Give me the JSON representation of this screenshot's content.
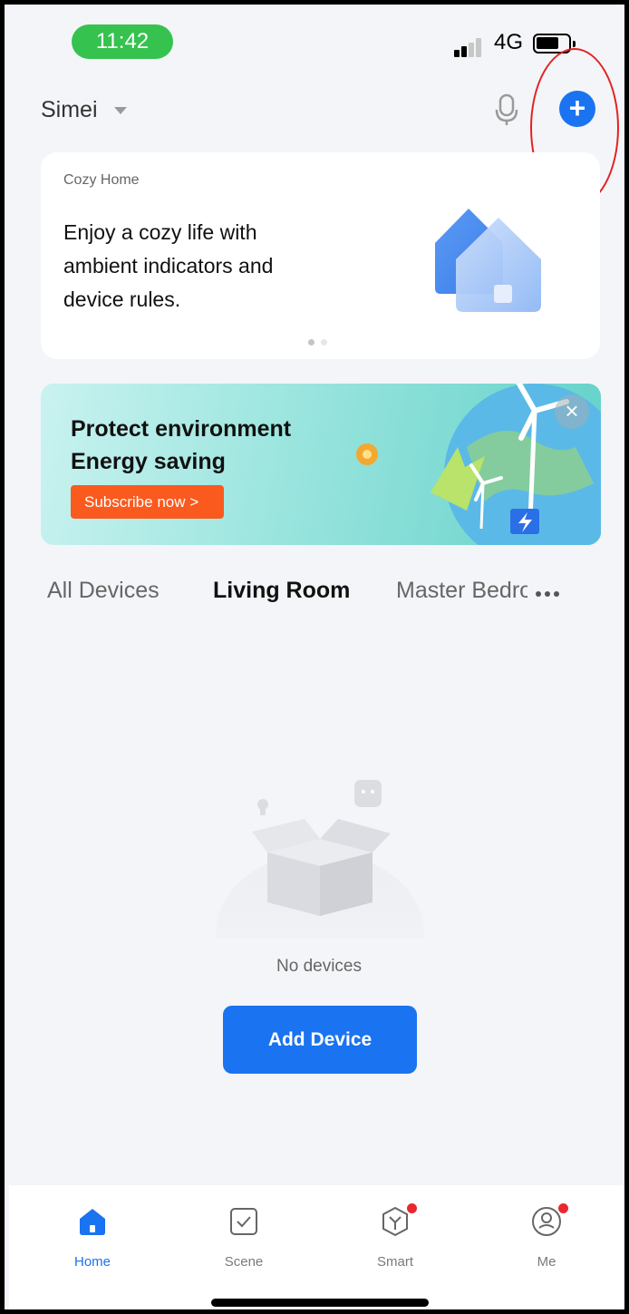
{
  "status_bar": {
    "time": "11:42",
    "network": "4G"
  },
  "header": {
    "home_name": "Simei"
  },
  "cozy_card": {
    "title": "Cozy Home",
    "text": "Enjoy a cozy life with ambient indicators and device rules."
  },
  "banner": {
    "line1": "Protect environment",
    "line2": "Energy saving",
    "cta": "Subscribe now >"
  },
  "tabs": [
    "All Devices",
    "Living Room",
    "Master Bedroom"
  ],
  "active_tab": "Living Room",
  "empty_state": {
    "message": "No devices",
    "button": "Add Device"
  },
  "bottom_nav": [
    {
      "label": "Home",
      "icon": "home-icon",
      "active": true
    },
    {
      "label": "Scene",
      "icon": "scene-icon",
      "active": false
    },
    {
      "label": "Smart",
      "icon": "smart-icon",
      "active": false,
      "badge": true
    },
    {
      "label": "Me",
      "icon": "profile-icon",
      "active": false,
      "badge": true
    }
  ],
  "colors": {
    "accent": "#1a73f0",
    "status_pill": "#35c24f",
    "cta": "#fa5a1e",
    "badge": "#e8282e",
    "annotation": "#e32222"
  }
}
